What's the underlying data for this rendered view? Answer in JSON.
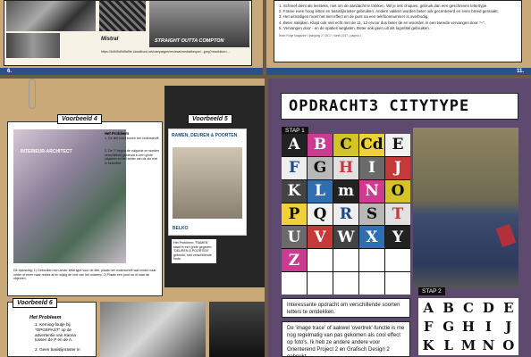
{
  "pages": {
    "top_left": {
      "page_number": "6.",
      "caption": "Mistral",
      "poster_text": "STRAIGHT OUTTA COMPTON",
      "url": "https://b4f49d9d9a9fe.cloudfront.net/campaigns/reviews/mediatheque/...jpeg?resolution=..."
    },
    "top_right": {
      "page_number": "11.",
      "lines": [
        "1. Schreef dient als leesteks, niet om de aandacht te trekken. Wil je iets chiques, gebruik dan een geschreven lettertype.",
        "2. Frame even hoog letten en basislijnraster gebruiken. Andere vakken worden beter ook gecentreerd en even breed gemaakt.",
        "3. Het uitnodigen moet het niet effect en de punt na een telefoonnummer is overbodig.",
        "4. Beter nakijken. Klopt ook niet echt met de 11, 12 ervoor dus beter de en woorden in een tweede vervangen door \"–\".",
        "5. Vervangen door - en de spaties weglaten. Beter ook geen uit als logo/titel gebruiken."
      ],
      "footer": "Brain Folge Magazine • jaargang 2 / 2017 • week 2017 • pagina 1"
    },
    "bottom_left": {
      "voorbeeld4_label": "Voorbeeld 4",
      "voorbeeld5_label": "Voorbeeld 5",
      "voorbeeld6_label": "Voorbeeld 6",
      "probleem_title": "Het Probleem",
      "probleem_items": [
        "1. De titel komt boven het onderschrift.",
        "2. De \"i\" begint de volgorde en worden verschillend gekleurd in een grote uitgaven en het ander van de zin niet in hetzelfde."
      ],
      "oplossing_text": "De oplossing: 1) Gebruiken een ander lettertype voor de titel, plaats het onderschrift wat verder naar onder of meer naar rechts af en wijzig de rest van het ontwerp. 2) Plaats een punt na of naar de objecten.",
      "advert_title": "INTERIEUR-ARCHITECT",
      "v5_heading": "RAMEN, DEUREN & POORTEN",
      "v5_brand": "BELKO",
      "v5_probleem": "Het Probleem: \"RAMEN\" staat in een grote gegeven \"DEUREN & POORTEN\" gebruikt, met verschillende fonts.",
      "v6_title": "Het Probleem",
      "v6_items": [
        "1. Kerning-foutje bij \"OPGEPAST\" op de advertentie van Kaona tussen de P en de A.",
        "2. Geen basislijnraster in"
      ]
    },
    "bottom_right": {
      "title": "OPDRACHT3 CITYTYPE",
      "stap1": "STAP 1",
      "stap2": "STAP 2",
      "grid_letters": [
        "A",
        "B",
        "C",
        "Cd",
        "E",
        "F",
        "G",
        "H",
        "I",
        "J",
        "K",
        "L",
        "m",
        "N",
        "O",
        "P",
        "Q",
        "R",
        "S",
        "T",
        "U",
        "V",
        "W",
        "X",
        "Y",
        "Z",
        "",
        "",
        "",
        "",
        "",
        "",
        "",
        "",
        ""
      ],
      "text1": "Interessante opdracht om verschillende soorten letters te ontdekken.",
      "text2": "De 'image trace' of aakwel 'overtrek'-functie is me nog regelmatig van pas gekomen als cool effect op foto's. Ik heb ze andere andere voor Orienterend Project 2 en Grafisch Design 2 gebruikt.",
      "stap2_letters": [
        "A",
        "B",
        "C",
        "D",
        "E",
        "F",
        "G",
        "H",
        "I",
        "J",
        "K",
        "L",
        "M",
        "N",
        "O"
      ]
    }
  },
  "colors": {
    "kraft": "#c9a978",
    "blue_bar": "#2b4f88",
    "purple": "#5e4a6e"
  }
}
